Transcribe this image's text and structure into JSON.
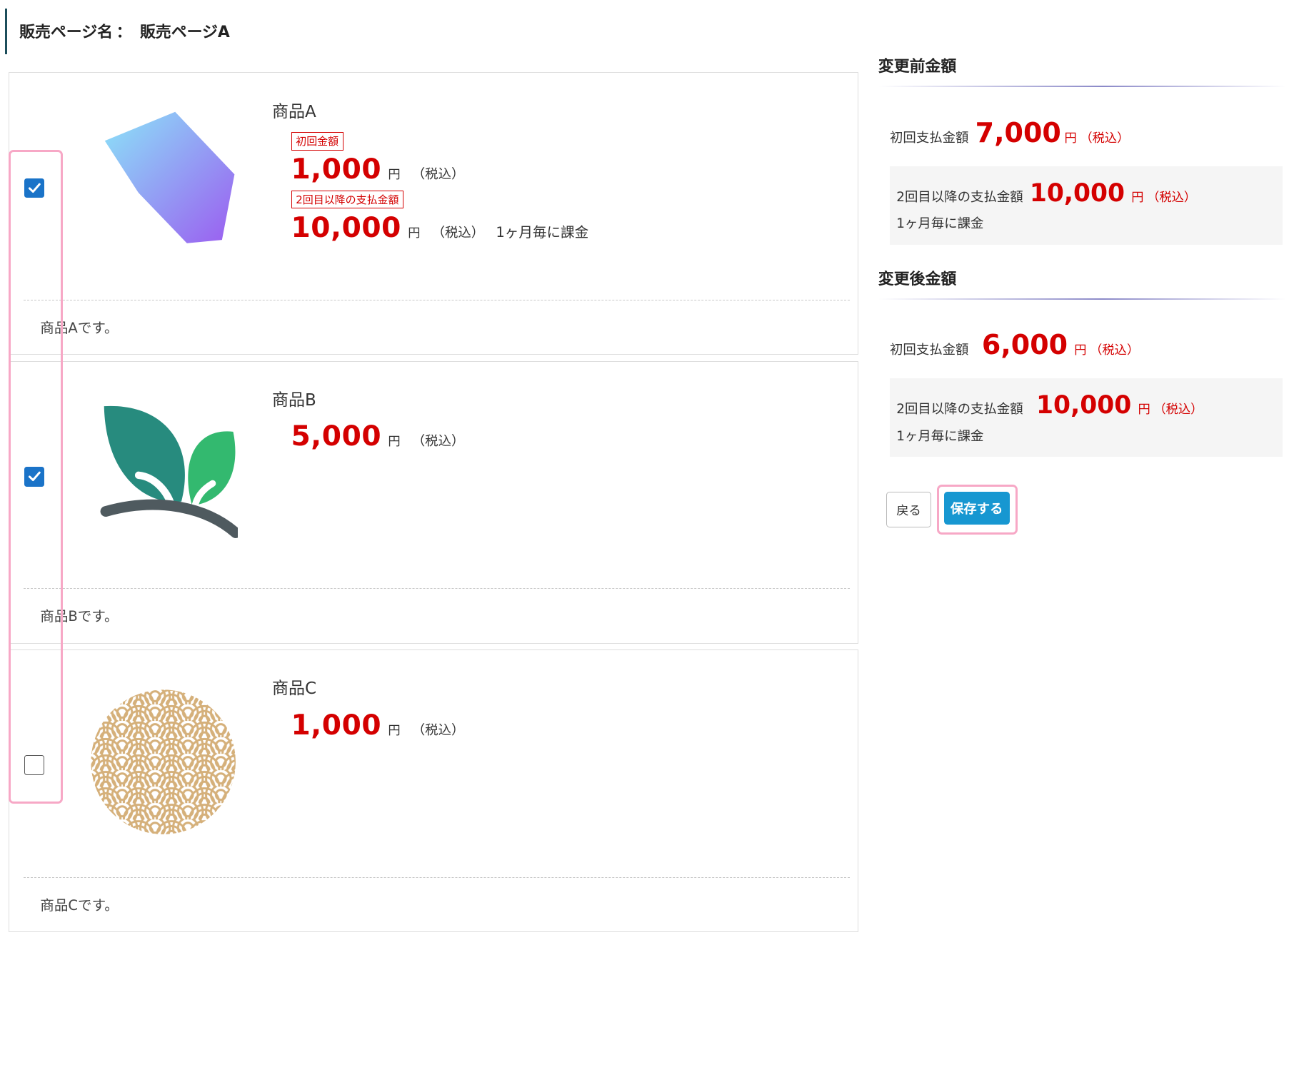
{
  "header": {
    "label": "販売ページ名",
    "separator": "：",
    "page_name": "販売ページA"
  },
  "products": [
    {
      "name": "商品A",
      "checked": true,
      "image": "crystal-logo",
      "first_badge": "初回金額",
      "first_price": "1,000",
      "yen": "円",
      "tax": "（税込）",
      "recurring_badge": "2回目以降の支払金額",
      "recurring_price": "10,000",
      "recurring_yen": "円",
      "recurring_tax": "（税込）",
      "cycle": "1ヶ月毎に課金",
      "description": "商品Aです。"
    },
    {
      "name": "商品B",
      "checked": true,
      "image": "leaf-sprout-logo",
      "price": "5,000",
      "yen": "円",
      "tax": "（税込）",
      "description": "商品Bです。"
    },
    {
      "name": "商品C",
      "checked": false,
      "image": "seigaiha-wave-pattern",
      "price": "1,000",
      "yen": "円",
      "tax": "（税込）",
      "description": "商品Cです。"
    }
  ],
  "summary": {
    "before": {
      "title": "変更前金額",
      "first_label": "初回支払金額",
      "first_price": "7,000",
      "first_yen": "円",
      "first_tax": "（税込）",
      "recurring_label": "2回目以降の支払金額",
      "recurring_price": "10,000",
      "recurring_yen": "円",
      "recurring_tax": "（税込）",
      "cycle": "1ヶ月毎に課金"
    },
    "after": {
      "title": "変更後金額",
      "first_label": "初回支払金額",
      "first_price": "6,000",
      "first_yen": "円",
      "first_tax": "（税込）",
      "recurring_label": "2回目以降の支払金額",
      "recurring_price": "10,000",
      "recurring_yen": "円",
      "recurring_tax": "（税込）",
      "cycle": "1ヶ月毎に課金"
    }
  },
  "actions": {
    "back_label": "戻る",
    "save_label": "保存する"
  },
  "colors": {
    "accent_red": "#d40000",
    "checkbox_blue": "#1a73c8",
    "save_blue": "#1797d1",
    "highlight_pink": "#f7a8c6",
    "header_bar": "#1c4e5b"
  }
}
